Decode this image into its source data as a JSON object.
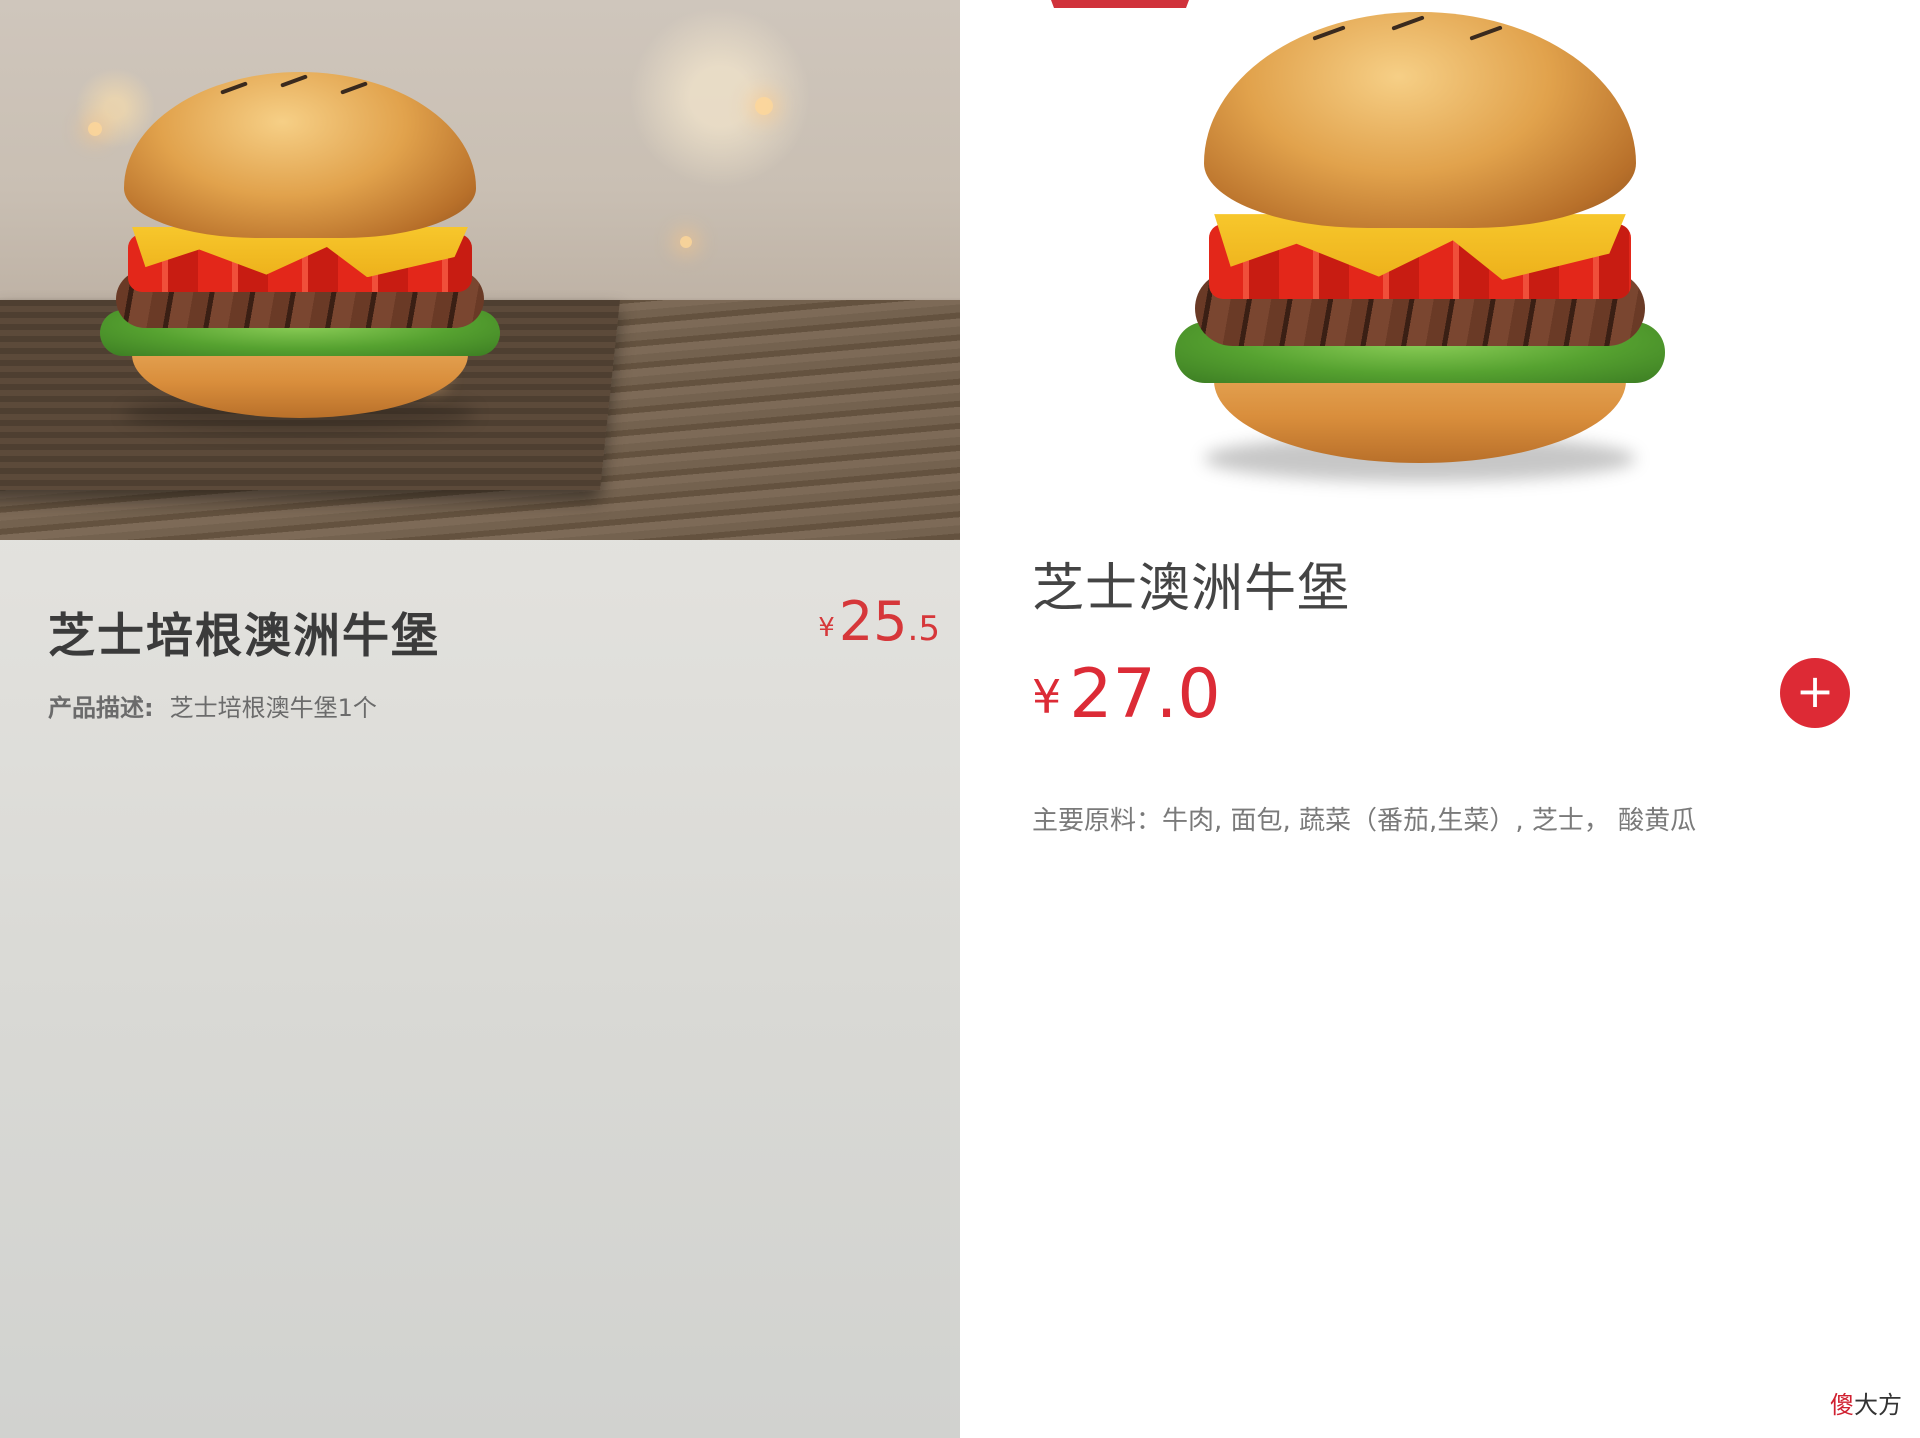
{
  "kiosk_screen": {
    "product_title": "芝士培根澳洲牛堡",
    "price": {
      "currency": "¥",
      "integer": "25",
      "decimal": ".5"
    },
    "description_label": "产品描述:",
    "description_value": "芝士培根澳牛堡1个"
  },
  "app_screen": {
    "product_title": "芝士澳洲牛堡",
    "price": {
      "currency": "¥",
      "value": "27.0"
    },
    "add_button_glyph": "+",
    "ingredients": "主要原料：牛肉, 面包, 蔬菜（番茄,生菜）, 芝士，  酸黄瓜"
  },
  "watermark": {
    "first_char": "傻",
    "rest": "大方"
  },
  "colors": {
    "accent_red": "#dd2a35",
    "price_red": "#d6373a",
    "title_gray": "#3b3b3b"
  },
  "icons": {
    "add": "plus-icon"
  }
}
